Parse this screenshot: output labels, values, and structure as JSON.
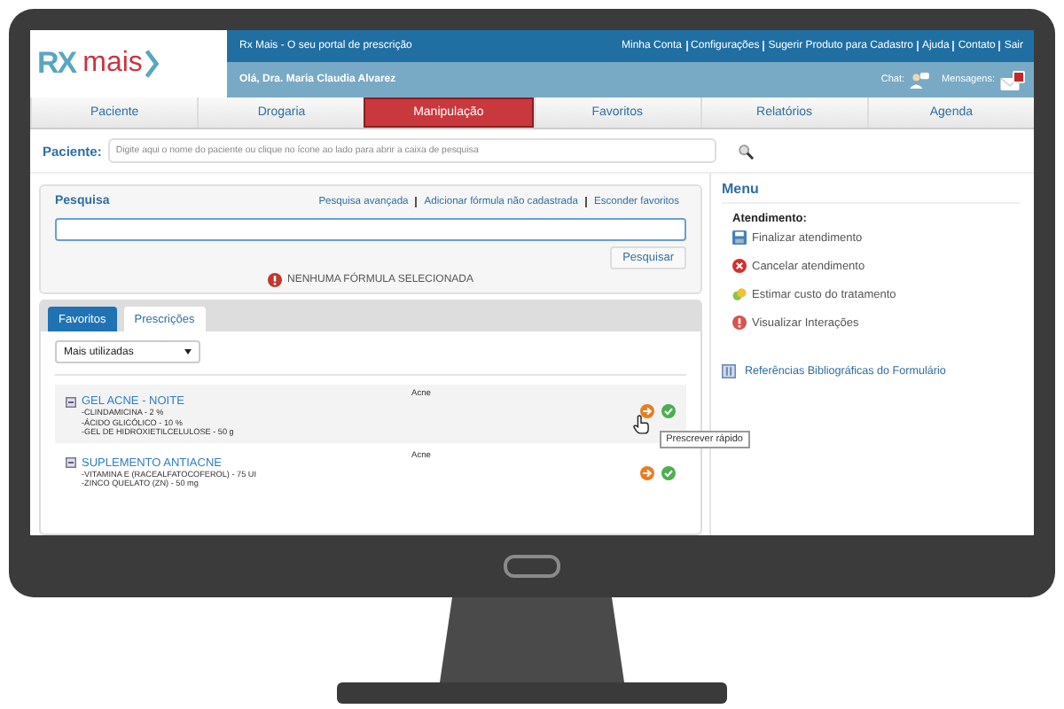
{
  "logo": {
    "left": "RX",
    "right": "mais"
  },
  "header": {
    "title": "Rx Mais - O seu portal de prescrição",
    "links": [
      "Minha Conta",
      "Configurações",
      "Sugerir Produto para Cadastro",
      "Ajuda",
      "Contato",
      "Sair"
    ],
    "greeting": "Olá, Dra. Maria Claudia Alvarez",
    "chat": "Chat:",
    "messages": "Mensagens:",
    "has_unread": true
  },
  "tabs": [
    {
      "label": "Paciente",
      "selected": false
    },
    {
      "label": "Drogaria",
      "selected": false
    },
    {
      "label": "Manipulação",
      "selected": true
    },
    {
      "label": "Favoritos",
      "selected": false
    },
    {
      "label": "Relatórios",
      "selected": false
    },
    {
      "label": "Agenda",
      "selected": false
    }
  ],
  "patient": {
    "label": "Paciente:",
    "placeholder": "Digite aqui o nome do paciente ou clique no ícone ao lado para abrir a caixa de pesquisa"
  },
  "search": {
    "title": "Pesquisa",
    "links": [
      "Pesquisa avançada",
      "Adicionar fórmula não cadastrada",
      "Esconder favoritos"
    ],
    "button": "Pesquisar",
    "warning": "NENHUMA FÓRMULA SELECIONADA"
  },
  "subtabs": [
    {
      "label": "Favoritos",
      "selected": true
    },
    {
      "label": "Prescrições",
      "selected": false
    }
  ],
  "filter": {
    "value": "Mais utilizadas"
  },
  "formulas": [
    {
      "name": "GEL ACNE - NOITE",
      "category": "Acne",
      "ingredients": [
        "-CLINDAMICINA - 2 %",
        "-ÁCIDO GLICÓLICO - 10 %",
        "-GEL DE HIDROXIETILCELULOSE - 50 g"
      ],
      "tooltip": "Prescrever rápido"
    },
    {
      "name": "SUPLEMENTO ANTIACNE",
      "category": "Acne",
      "ingredients": [
        "-VITAMINA E (RACEALFATOCOFEROL) - 75 UI",
        "-ZINCO QUELATO (ZN) - 50 mg"
      ]
    }
  ],
  "menu": {
    "title": "Menu",
    "section": "Atendimento:",
    "items": [
      {
        "kind": "save",
        "label": "Finalizar atendimento"
      },
      {
        "kind": "cancel",
        "label": "Cancelar atendimento"
      },
      {
        "kind": "estimate",
        "label": "Estimar custo do tratamento"
      },
      {
        "kind": "interactions",
        "label": "Visualizar Interações"
      }
    ],
    "reference": "Referências Bibliográficas do Formulário"
  }
}
